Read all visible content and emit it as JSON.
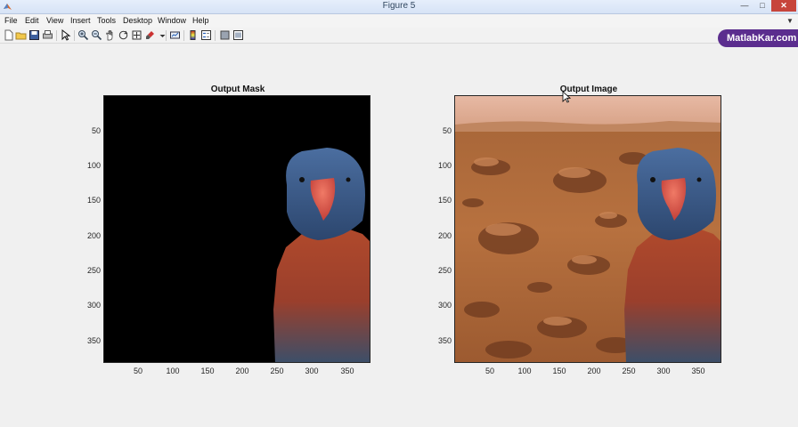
{
  "window": {
    "title": "Figure 5"
  },
  "menu": [
    "File",
    "Edit",
    "View",
    "Insert",
    "Tools",
    "Desktop",
    "Window",
    "Help"
  ],
  "watermark": "MatlabKar.com",
  "toolbar_icons": [
    "new-figure-icon",
    "open-file-icon",
    "save-icon",
    "print-icon",
    "pointer-icon",
    "zoom-in-icon",
    "zoom-out-icon",
    "pan-icon",
    "rotate-3d-icon",
    "data-cursor-icon",
    "brush-icon",
    "link-plot-icon",
    "colorbar-icon",
    "legend-icon",
    "hide-plot-tools-icon",
    "show-plot-tools-icon"
  ],
  "axes": [
    {
      "title": "Output Mask",
      "content": "black background with segmented parrot on right",
      "yticks": [
        "50",
        "100",
        "150",
        "200",
        "250",
        "300",
        "350"
      ],
      "xticks": [
        "50",
        "100",
        "150",
        "200",
        "250",
        "300",
        "350"
      ]
    },
    {
      "title": "Output Image",
      "content": "parrot composited over Mars desert landscape",
      "yticks": [
        "50",
        "100",
        "150",
        "200",
        "250",
        "300",
        "350"
      ],
      "xticks": [
        "50",
        "100",
        "150",
        "200",
        "250",
        "300",
        "350"
      ]
    }
  ],
  "colors": {
    "parrot_head": "#3a5a8c",
    "parrot_body": "#a2452e",
    "beak": "#d9574a",
    "mars": "#a35f35"
  }
}
